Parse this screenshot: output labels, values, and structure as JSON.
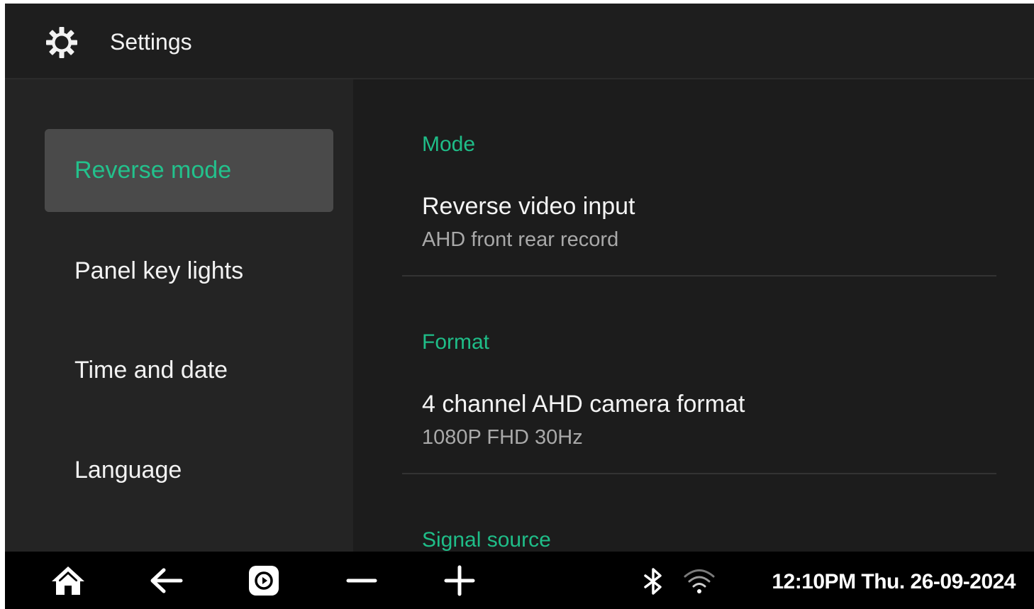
{
  "header": {
    "title": "Settings",
    "icon": "gear-icon"
  },
  "sidebar": {
    "items": [
      {
        "label": "Reverse mode",
        "active": true
      },
      {
        "label": "Panel key lights",
        "active": false
      },
      {
        "label": "Time and date",
        "active": false
      },
      {
        "label": "Language",
        "active": false
      }
    ]
  },
  "content": {
    "sections": [
      {
        "label": "Mode",
        "setting": {
          "title": "Reverse video input",
          "value": "AHD front rear record"
        }
      },
      {
        "label": "Format",
        "setting": {
          "title": "4 channel AHD camera format",
          "value": "1080P FHD 30Hz"
        }
      },
      {
        "label": "Signal source"
      }
    ]
  },
  "navbar": {
    "icons": [
      "home-icon",
      "back-arrow-icon",
      "carplay-icon",
      "volume-down-icon",
      "volume-up-icon"
    ],
    "status_icons": [
      "bluetooth-icon",
      "wifi-icon"
    ],
    "clock": "12:10PM Thu. 26-09-2024"
  },
  "colors": {
    "accent": "#1fbd88",
    "background": "#1b1b1b",
    "sidebar": "#242424",
    "active_item": "#4a4a4a",
    "navbar": "#000000"
  }
}
